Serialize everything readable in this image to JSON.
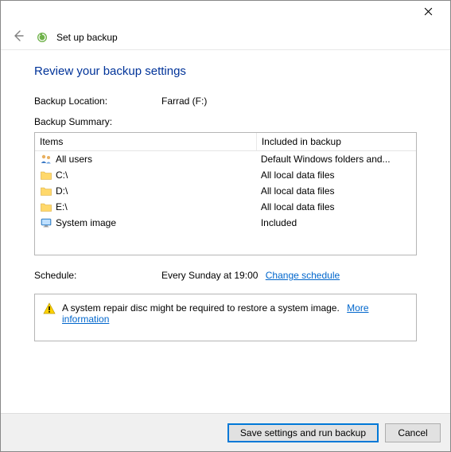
{
  "window": {
    "title": "Set up backup"
  },
  "page": {
    "heading": "Review your backup settings"
  },
  "backup_location": {
    "label": "Backup Location:",
    "value": "Farrad (F:)"
  },
  "summary": {
    "label": "Backup Summary:",
    "columns": {
      "items": "Items",
      "included": "Included in backup"
    },
    "rows": [
      {
        "icon": "users-icon",
        "item": "All users",
        "included": "Default Windows folders and..."
      },
      {
        "icon": "folder-icon",
        "item": "C:\\",
        "included": "All local data files"
      },
      {
        "icon": "folder-icon",
        "item": "D:\\",
        "included": "All local data files"
      },
      {
        "icon": "folder-icon",
        "item": "E:\\",
        "included": "All local data files"
      },
      {
        "icon": "monitor-icon",
        "item": "System image",
        "included": "Included"
      }
    ]
  },
  "schedule": {
    "label": "Schedule:",
    "value": "Every Sunday at 19:00",
    "change_link": "Change schedule"
  },
  "warning": {
    "text": "A system repair disc might be required to restore a system image.",
    "more_info": "More information"
  },
  "footer": {
    "primary": "Save settings and run backup",
    "cancel": "Cancel"
  }
}
